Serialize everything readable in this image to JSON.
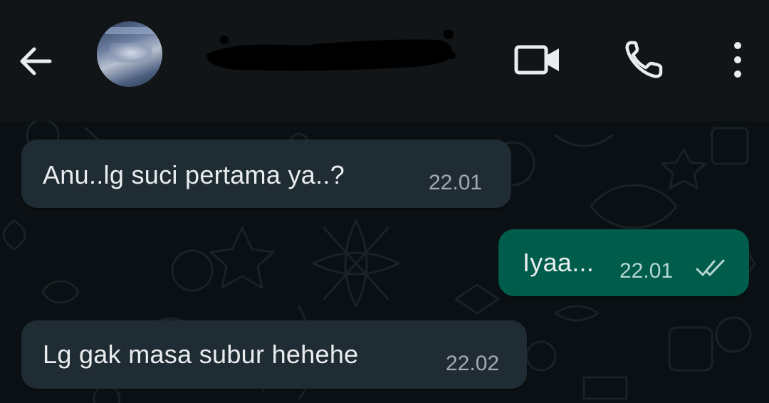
{
  "header": {
    "back_icon": "arrow-left-icon",
    "avatar_icon": "contact-avatar",
    "contact_name": "",
    "video_icon": "video-camera-icon",
    "call_icon": "phone-icon",
    "menu_icon": "more-vert-icon"
  },
  "messages": [
    {
      "direction": "incoming",
      "text": "Anu..lg suci pertama ya..?",
      "time": "22.01"
    },
    {
      "direction": "outgoing",
      "text": "Iyaa...",
      "time": "22.01",
      "status_icon": "double-check-icon"
    },
    {
      "direction": "incoming",
      "text": "Lg gak masa subur hehehe",
      "time": "22.02"
    }
  ],
  "colors": {
    "header_bg": "#111517",
    "chat_bg": "#0b1014",
    "incoming_bubble": "#202c33",
    "outgoing_bubble": "#005c4b",
    "text": "#e9edef",
    "meta_text": "#a0abb1"
  }
}
